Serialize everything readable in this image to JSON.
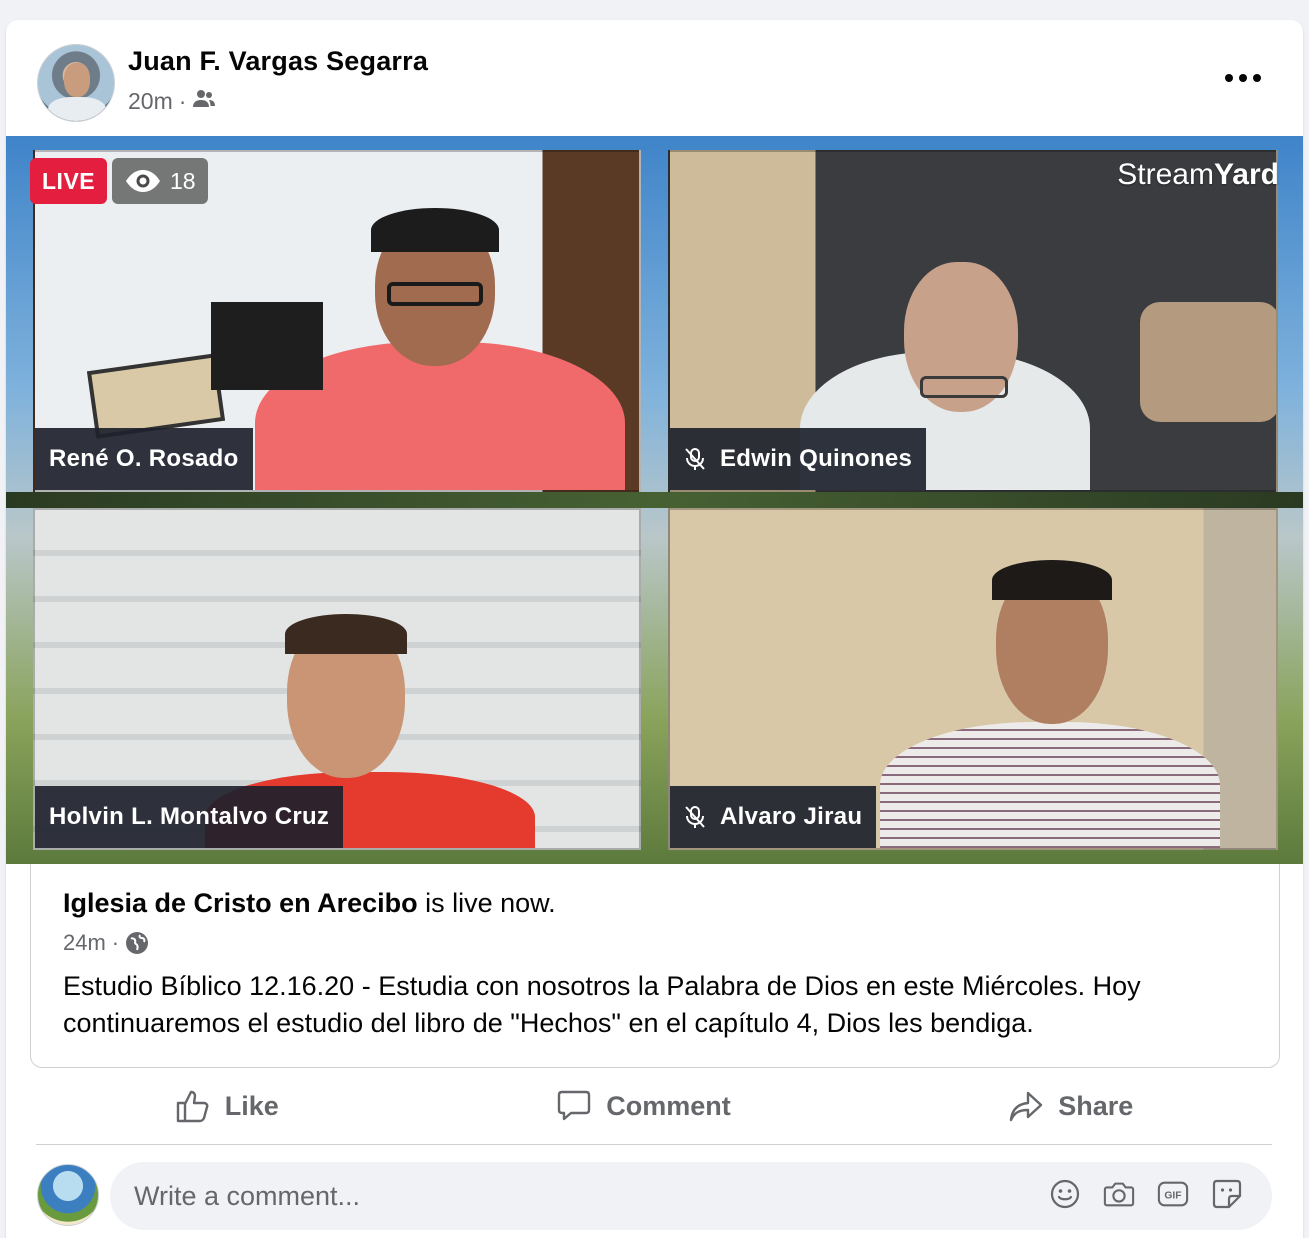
{
  "post": {
    "author": "Juan F. Vargas Segarra",
    "time": "20m",
    "separator": "·",
    "audience_icon": "friends-icon",
    "more_icon": "more-options-icon"
  },
  "live": {
    "badge": "LIVE",
    "viewers": "18",
    "viewers_icon": "eye-icon",
    "brand_light": "Stream",
    "brand_bold": "Yard"
  },
  "participants": [
    {
      "name": "René O. Rosado",
      "muted": false
    },
    {
      "name": "Edwin Quinones",
      "muted": true
    },
    {
      "name": "Holvin L. Montalvo Cruz",
      "muted": false
    },
    {
      "name": "Alvaro Jirau",
      "muted": true
    }
  ],
  "shared": {
    "page_name": "Iglesia de Cristo en Arecibo",
    "status_text": "is live now.",
    "time": "24m",
    "separator": "·",
    "audience_icon": "globe-icon",
    "body": "Estudio Bíblico 12.16.20 - Estudia con nosotros la Palabra de Dios en este Miércoles. Hoy continuaremos el estudio del libro de \"Hechos\" en el capítulo 4, Dios les bendiga."
  },
  "actions": {
    "like": "Like",
    "comment": "Comment",
    "share": "Share"
  },
  "comment_box": {
    "placeholder": "Write a comment...",
    "icons": [
      "emoji-icon",
      "camera-icon",
      "gif-icon",
      "sticker-icon"
    ]
  },
  "colors": {
    "live_red": "#e41e3f",
    "secondary_text": "#65676b",
    "tag_bg": "#1e222c"
  }
}
